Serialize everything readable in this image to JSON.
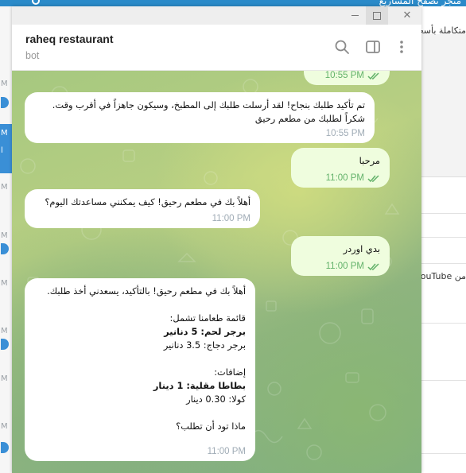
{
  "background_window": {
    "topbar_text": "متجر تصفح المشاريع",
    "right_text_1": "متكاملة بأسعار",
    "right_text_2": "YouTube من",
    "sidebar_letters": [
      "M",
      "M",
      "M",
      "M",
      "M",
      "M",
      "M",
      "M"
    ],
    "selected_letters": [
      "M",
      "ا"
    ]
  },
  "window": {
    "minimize_label": "—",
    "close_label": "✕"
  },
  "header": {
    "title": "raheq restaurant",
    "subtitle": "bot",
    "icons": [
      "search-icon",
      "sidebar-panel-icon",
      "more-vertical-icon"
    ]
  },
  "messages": [
    {
      "direction": "out",
      "lines": [],
      "time": "10:55 PM",
      "status": "read"
    },
    {
      "direction": "in",
      "lines": [
        {
          "text": "تم تأكيد طلبك بنجاح! لقد أرسلت طلبك إلى المطبخ، وسيكون جاهزاً في أقرب وقت.",
          "bold": false
        },
        {
          "text": "شكراً لطلبك من مطعم رحيق",
          "bold": false
        }
      ],
      "time": "10:55 PM"
    },
    {
      "direction": "out",
      "lines": [
        {
          "text": "مرحبا",
          "bold": false
        }
      ],
      "time": "11:00 PM",
      "status": "read"
    },
    {
      "direction": "in",
      "lines": [
        {
          "text": "أهلاً بك في مطعم رحيق! كيف يمكنني مساعدتك اليوم؟",
          "bold": false
        }
      ],
      "time": "11:00 PM"
    },
    {
      "direction": "out",
      "lines": [
        {
          "text": "بدي اوردر",
          "bold": false
        }
      ],
      "time": "11:00 PM",
      "status": "read"
    },
    {
      "direction": "in",
      "lines": [
        {
          "text": "أهلاً بك في مطعم رحيق! بالتأكيد، يسعدني أخذ طلبك.",
          "bold": false
        },
        {
          "text": "",
          "bold": false
        },
        {
          "text": "قائمة طعامنا تشمل:",
          "bold": false
        },
        {
          "text": "برجر لحم: 5 دنانير",
          "bold": true
        },
        {
          "text": "برجر دجاج: 3.5 دنانير",
          "bold": false
        },
        {
          "text": "",
          "bold": false
        },
        {
          "text": "إضافات:",
          "bold": false
        },
        {
          "text": "بطاطا مقلية: 1 دينار",
          "bold": true
        },
        {
          "text": "كولا: 0.30 دينار",
          "bold": false
        },
        {
          "text": "",
          "bold": false
        },
        {
          "text": "ماذا تود أن تطلب؟",
          "bold": false
        }
      ],
      "time": "11:00 PM"
    }
  ],
  "colors": {
    "incoming_bubble": "#ffffff",
    "outgoing_bubble": "#effdde",
    "read_check": "#63b26a",
    "accent": "#2a8ac9"
  }
}
